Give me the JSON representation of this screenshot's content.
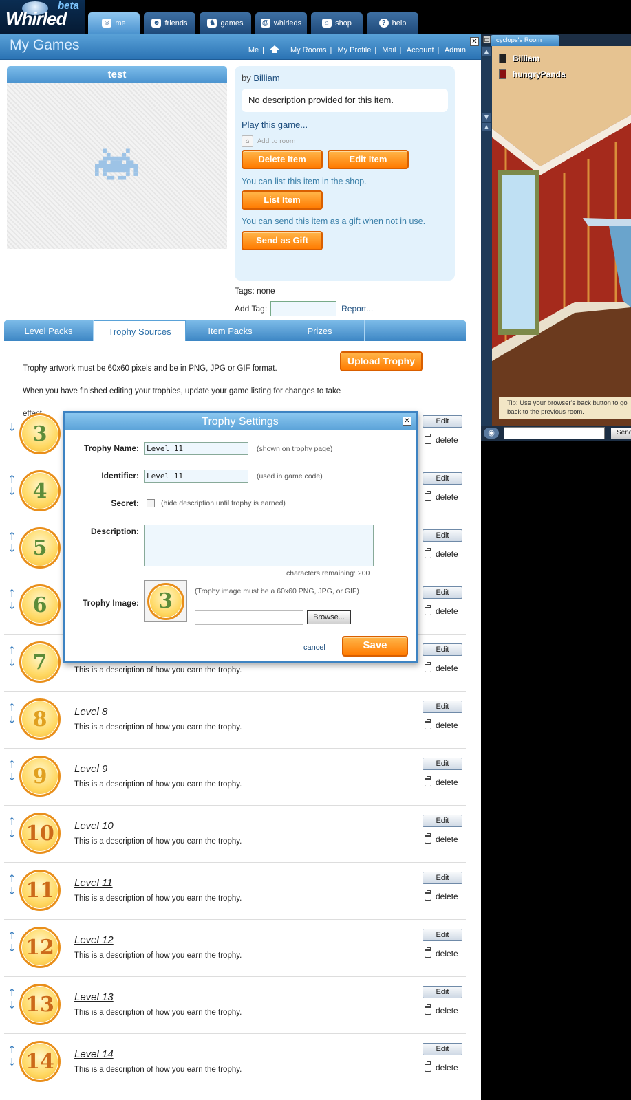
{
  "app": {
    "logo": "Whirled",
    "logo_badge": "beta"
  },
  "nav_tabs": [
    {
      "label": "me",
      "icon": "smiley-icon"
    },
    {
      "label": "friends",
      "icon": "friends-icon"
    },
    {
      "label": "games",
      "icon": "invader-icon"
    },
    {
      "label": "whirleds",
      "icon": "whirled-icon"
    },
    {
      "label": "shop",
      "icon": "bag-icon"
    },
    {
      "label": "help",
      "icon": "help-icon"
    }
  ],
  "header": {
    "title": "My Games",
    "links": [
      "Me",
      "My Rooms",
      "My Profile",
      "Mail",
      "Account",
      "Admin"
    ]
  },
  "item": {
    "name": "test",
    "by_prefix": "by",
    "creator": "Billiam",
    "description": "No description provided for this item.",
    "play_link": "Play this game...",
    "add_to_room": "Add to room",
    "delete_label": "Delete Item",
    "edit_label": "Edit Item",
    "shop_note": "You can list this item in the shop.",
    "list_label": "List Item",
    "gift_note": "You can send this item as a gift when not in use.",
    "gift_label": "Send as Gift"
  },
  "tags": {
    "label": "Tags:",
    "value": "none",
    "add_label": "Add Tag:",
    "report_link": "Report..."
  },
  "tabs": [
    "Level Packs",
    "Trophy Sources",
    "Item Packs",
    "Prizes"
  ],
  "trophy_page": {
    "instruction1": "Trophy artwork must be 60x60 pixels and be in PNG, JPG or GIF format.",
    "instruction2": "When you have finished editing your trophies, update your game listing for changes to take effect.",
    "upload_label": "Upload Trophy",
    "edit_label": "Edit",
    "delete_label": "delete"
  },
  "trophies": [
    {
      "number": "3",
      "name": "",
      "desc": ""
    },
    {
      "number": "4",
      "name": "",
      "desc": ""
    },
    {
      "number": "5",
      "name": "",
      "desc": ""
    },
    {
      "number": "6",
      "name": "",
      "desc": ""
    },
    {
      "number": "7",
      "name": "",
      "desc": "This is a description of how you earn the trophy."
    },
    {
      "number": "8",
      "name": "Level 8",
      "desc": "This is a description of how you earn the trophy."
    },
    {
      "number": "9",
      "name": "Level 9",
      "desc": "This is a description of how you earn the trophy."
    },
    {
      "number": "10",
      "name": "Level 10",
      "desc": "This is a description of how you earn the trophy."
    },
    {
      "number": "11",
      "name": "Level 11",
      "desc": "This is a description of how you earn the trophy."
    },
    {
      "number": "12",
      "name": "Level 12",
      "desc": "This is a description of how you earn the trophy."
    },
    {
      "number": "13",
      "name": "Level 13",
      "desc": "This is a description of how you earn the trophy."
    },
    {
      "number": "14",
      "name": "Level 14",
      "desc": "This is a description of how you earn the trophy."
    }
  ],
  "modal": {
    "title": "Trophy Settings",
    "name_label": "Trophy Name:",
    "name_value": "Level 11",
    "name_hint": "(shown on trophy page)",
    "id_label": "Identifier:",
    "id_value": "Level 11",
    "id_hint": "(used in game code)",
    "secret_label": "Secret:",
    "secret_hint": "(hide description until trophy is earned)",
    "desc_label": "Description:",
    "chars_remaining": "characters remaining: 200",
    "image_label": "Trophy Image:",
    "image_number": "3",
    "image_hint": "(Trophy image must be a 60x60 PNG, JPG, or GIF)",
    "browse_label": "Browse...",
    "cancel_label": "cancel",
    "save_label": "Save"
  },
  "room": {
    "title": "cyclops's Room",
    "occupants": [
      "Billiam",
      "hungryPanda"
    ],
    "tip": "Tip: Use your browser's back button to go back to the previous room.",
    "send_label": "Send"
  }
}
